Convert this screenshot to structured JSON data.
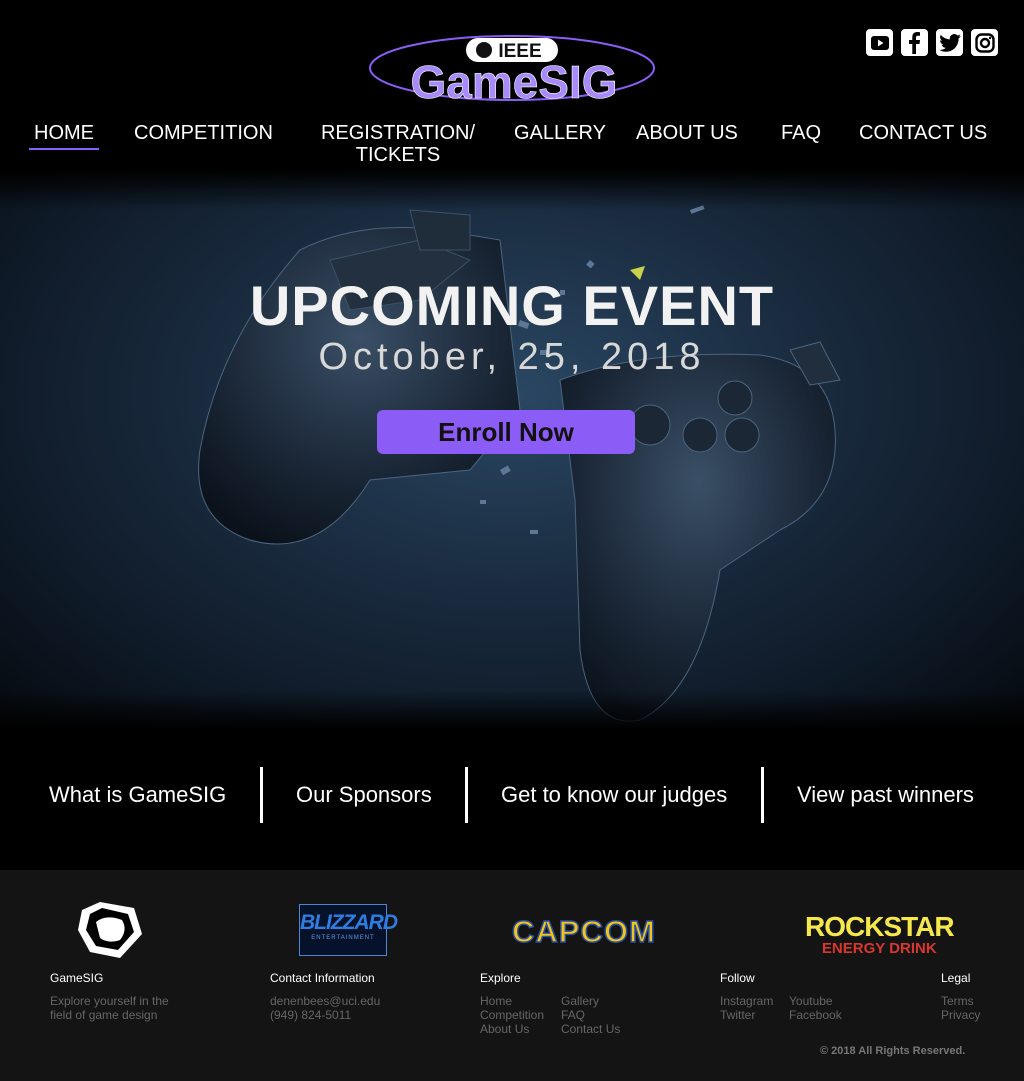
{
  "header": {
    "logo": {
      "top_text": "IEEE",
      "main_text": "GameSIG"
    },
    "social": [
      {
        "icon": "youtube-icon"
      },
      {
        "icon": "facebook-icon"
      },
      {
        "icon": "twitter-icon"
      },
      {
        "icon": "instagram-icon"
      }
    ],
    "nav": {
      "home": "HOME",
      "competition": "COMPETITION",
      "registration_line1": "REGISTRATION/",
      "registration_line2": "TICKETS",
      "gallery": "GALLERY",
      "about": "ABOUT US",
      "faq": "FAQ",
      "contact": "CONTACT US"
    }
  },
  "hero": {
    "title": "UPCOMING EVENT",
    "date": "October, 25, 2018",
    "button": "Enroll Now"
  },
  "strip": {
    "what": "What is GameSIG",
    "sponsors": "Our Sponsors",
    "judges": "Get to know our judges",
    "winners": "View past winners"
  },
  "sponsors": {
    "blizzard": "BLIZZARD",
    "blizzard_sub": "ENTERTAINMENT",
    "capcom": "CAPCOM",
    "rockstar": "ROCKSTAR",
    "rockstar_sub": "ENERGY DRINK"
  },
  "footer": {
    "gamesig": {
      "title": "GameSIG",
      "line1": "Explore yourself in the",
      "line2": "field of game design"
    },
    "contact": {
      "title": "Contact Information",
      "email": "denenbees@uci.edu",
      "phone": "(949) 824-5011"
    },
    "explore": {
      "title": "Explore",
      "home": "Home",
      "competition": "Competition",
      "about": "About Us",
      "gallery": "Gallery",
      "faq": "FAQ",
      "contact": "Contact Us"
    },
    "follow": {
      "title": "Follow",
      "instagram": "Instagram",
      "twitter": "Twitter",
      "youtube": "Youtube",
      "facebook": "Facebook"
    },
    "legal": {
      "title": "Legal",
      "terms": "Terms",
      "privacy": "Privacy"
    },
    "copyright": "© 2018 All Rights Reserved."
  },
  "colors": {
    "accent": "#8b5cf6",
    "background": "#000000",
    "footer": "#141414"
  }
}
